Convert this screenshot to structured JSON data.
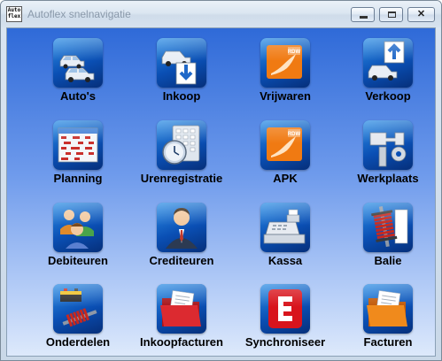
{
  "window": {
    "title": "Autoflex snelnavigatie",
    "app_icon_text": [
      "Auto",
      "flex"
    ]
  },
  "tiles": [
    {
      "label": "Auto's",
      "icon": "cars-icon"
    },
    {
      "label": "Inkoop",
      "icon": "car-purchase-icon"
    },
    {
      "label": "Vrijwaren",
      "icon": "rdw-icon"
    },
    {
      "label": "Verkoop",
      "icon": "car-sale-icon"
    },
    {
      "label": "Planning",
      "icon": "planning-grid-icon"
    },
    {
      "label": "Urenregistratie",
      "icon": "clock-calculator-icon"
    },
    {
      "label": "APK",
      "icon": "rdw-icon"
    },
    {
      "label": "Werkplaats",
      "icon": "wrench-icon"
    },
    {
      "label": "Debiteuren",
      "icon": "people-group-icon"
    },
    {
      "label": "Crediteuren",
      "icon": "businessman-icon"
    },
    {
      "label": "Kassa",
      "icon": "cash-register-icon"
    },
    {
      "label": "Balie",
      "icon": "shock-absorber-icon"
    },
    {
      "label": "Onderdelen",
      "icon": "parts-icon"
    },
    {
      "label": "Inkoopfacturen",
      "icon": "folder-red-icon"
    },
    {
      "label": "Synchroniseer",
      "icon": "sync-e-icon"
    },
    {
      "label": "Facturen",
      "icon": "folder-orange-icon"
    }
  ],
  "rdw_text": "RDW",
  "colors": {
    "tile_blue": "#0a4fb4",
    "rdw_orange": "#f07a12",
    "sync_red": "#d8141c"
  }
}
